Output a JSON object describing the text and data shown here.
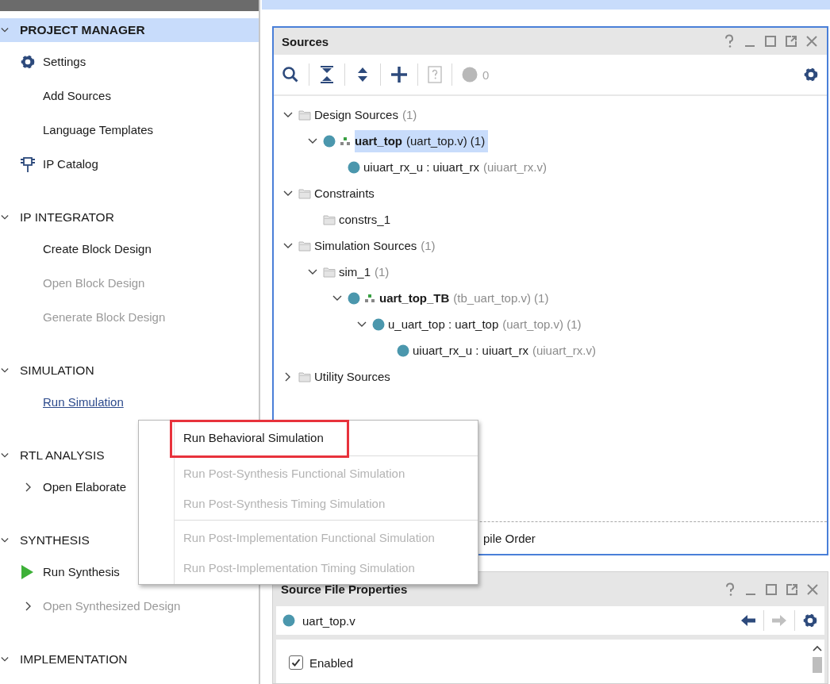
{
  "sidebar": {
    "sections": [
      {
        "title": "PROJECT MANAGER",
        "selected": true,
        "expanded": true,
        "items": [
          {
            "label": "Settings",
            "kind": "settings",
            "disabled": false,
            "hovered": false
          },
          {
            "label": "Add Sources",
            "kind": "text",
            "disabled": false,
            "hovered": false
          },
          {
            "label": "Language Templates",
            "kind": "text",
            "disabled": false,
            "hovered": false
          },
          {
            "label": "IP Catalog",
            "kind": "catalog",
            "disabled": false,
            "hovered": false
          }
        ]
      },
      {
        "title": "IP INTEGRATOR",
        "selected": false,
        "expanded": true,
        "items": [
          {
            "label": "Create Block Design",
            "kind": "text",
            "disabled": false,
            "hovered": false
          },
          {
            "label": "Open Block Design",
            "kind": "text",
            "disabled": true,
            "hovered": false
          },
          {
            "label": "Generate Block Design",
            "kind": "text",
            "disabled": true,
            "hovered": false
          }
        ]
      },
      {
        "title": "SIMULATION",
        "selected": false,
        "expanded": true,
        "items": [
          {
            "label": "Run Simulation",
            "kind": "text",
            "disabled": false,
            "hovered": true
          }
        ]
      },
      {
        "title": "RTL ANALYSIS",
        "selected": false,
        "expanded": true,
        "items": [
          {
            "label": "Open Elaborate",
            "kind": "expandable",
            "disabled": false,
            "hovered": false
          }
        ]
      },
      {
        "title": "SYNTHESIS",
        "selected": false,
        "expanded": true,
        "items": [
          {
            "label": "Run Synthesis",
            "kind": "run",
            "disabled": false,
            "hovered": false
          },
          {
            "label": "Open Synthesized Design",
            "kind": "expandable",
            "disabled": true,
            "hovered": false
          }
        ]
      },
      {
        "title": "IMPLEMENTATION",
        "selected": false,
        "expanded": true
      }
    ]
  },
  "sources_panel": {
    "title": "Sources",
    "toolbar": [
      {
        "kind": "search",
        "disabled": false
      },
      {
        "kind": "collapse",
        "disabled": false
      },
      {
        "kind": "expand",
        "disabled": false
      },
      {
        "kind": "add",
        "disabled": false
      },
      {
        "kind": "help",
        "disabled": true
      },
      {
        "kind": "messages",
        "disabled": true,
        "count": "0"
      },
      {
        "kind": "settings",
        "disabled": false
      }
    ],
    "tree": [
      {
        "kind": "folder",
        "name": "Design Sources",
        "suffix": "(1)",
        "expanded": true,
        "selected": false,
        "children": [
          {
            "kind": "module",
            "name": "uart_top",
            "suffix": "(uart_top.v) (1)",
            "top": true,
            "expanded": true,
            "selected": true,
            "children": [
              {
                "kind": "module",
                "name": "uiuart_rx_u : uiuart_rx",
                "suffix": "(uiuart_rx.v)",
                "top": false,
                "selected": false
              }
            ]
          }
        ]
      },
      {
        "kind": "folder",
        "name": "Constraints",
        "expanded": true,
        "selected": false,
        "children": [
          {
            "kind": "folder",
            "name": "constrs_1",
            "selected": false
          }
        ]
      },
      {
        "kind": "folder",
        "name": "Simulation Sources",
        "suffix": "(1)",
        "expanded": true,
        "selected": false,
        "children": [
          {
            "kind": "folder",
            "name": "sim_1",
            "suffix": "(1)",
            "expanded": true,
            "selected": false,
            "children": [
              {
                "kind": "module",
                "name": "uart_top_TB",
                "suffix": "(tb_uart_top.v) (1)",
                "top": true,
                "expanded": true,
                "selected": false,
                "children": [
                  {
                    "kind": "module",
                    "name": "u_uart_top : uart_top",
                    "suffix": "(uart_top.v) (1)",
                    "top": false,
                    "expanded": true,
                    "selected": false,
                    "children": [
                      {
                        "kind": "module",
                        "name": "uiuart_rx_u : uiuart_rx",
                        "suffix": "(uiuart_rx.v)",
                        "top": false,
                        "selected": false
                      }
                    ]
                  }
                ]
              }
            ]
          }
        ]
      },
      {
        "kind": "folder",
        "name": "Utility Sources",
        "expanded": false,
        "selected": false
      }
    ],
    "bottom_tab": "pile Order"
  },
  "properties_panel": {
    "title": "Source File Properties",
    "file": "uart_top.v",
    "back_enabled": true,
    "forward_enabled": false,
    "checkbox": {
      "label": "Enabled",
      "checked": true
    }
  },
  "context_menu": {
    "groups": [
      [
        {
          "label": "Run Behavioral Simulation",
          "disabled": false,
          "highlighted": true
        }
      ],
      [
        {
          "label": "Run Post-Synthesis Functional Simulation",
          "disabled": true,
          "highlighted": false
        },
        {
          "label": "Run Post-Synthesis Timing Simulation",
          "disabled": true,
          "highlighted": false
        }
      ],
      [
        {
          "label": "Run Post-Implementation Functional Simulation",
          "disabled": true,
          "highlighted": false
        },
        {
          "label": "Run Post-Implementation Timing Simulation",
          "disabled": true,
          "highlighted": false
        }
      ]
    ]
  }
}
